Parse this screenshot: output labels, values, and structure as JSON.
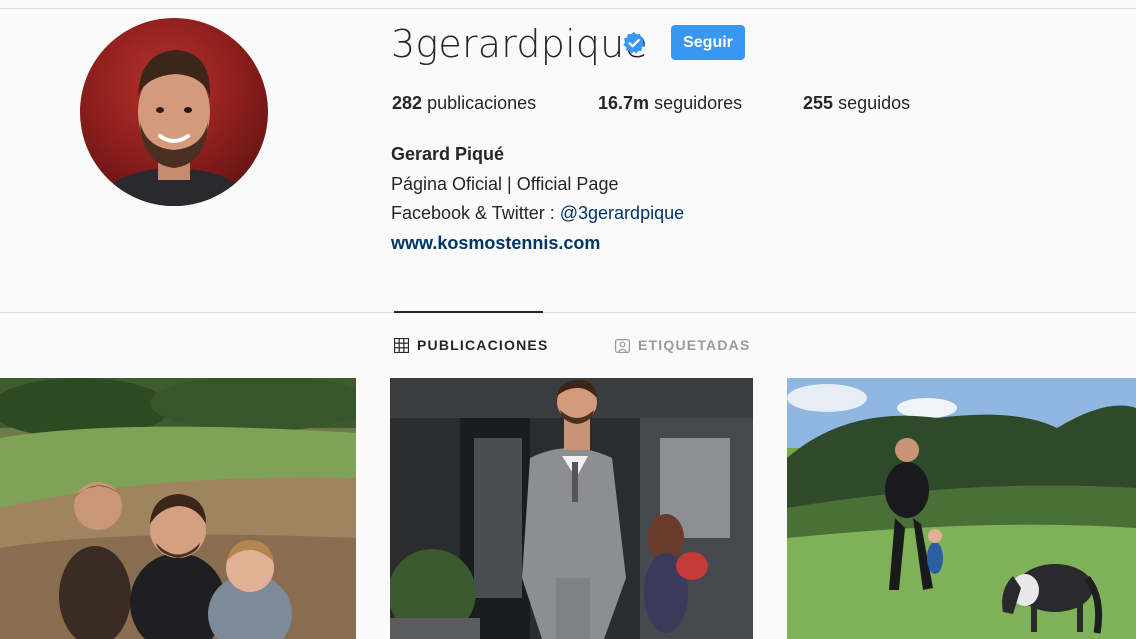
{
  "profile": {
    "username": "3gerardpique",
    "verified_icon": "verified-badge-icon",
    "follow_label": "Seguir",
    "stats": {
      "posts_count": "282",
      "posts_label": "publicaciones",
      "followers_count": "16.7m",
      "followers_label": "seguidores",
      "following_count": "255",
      "following_label": "seguidos"
    },
    "bio": {
      "full_name": "Gerard Piqué",
      "line1": "Página Oficial | Official Page",
      "line2_prefix": "Facebook & Twitter : ",
      "line2_mention": "@3gerardpique",
      "website": "www.kosmostennis.com"
    }
  },
  "tabs": [
    {
      "label": "PUBLICACIONES",
      "icon": "grid-icon",
      "active": true
    },
    {
      "label": "ETIQUETADAS",
      "icon": "tagged-icon",
      "active": false
    }
  ],
  "colors": {
    "accent": "#3897f0",
    "link": "#003569",
    "text": "#262626",
    "muted": "#999999",
    "background": "#fafafa",
    "border": "#dbdbdb"
  }
}
